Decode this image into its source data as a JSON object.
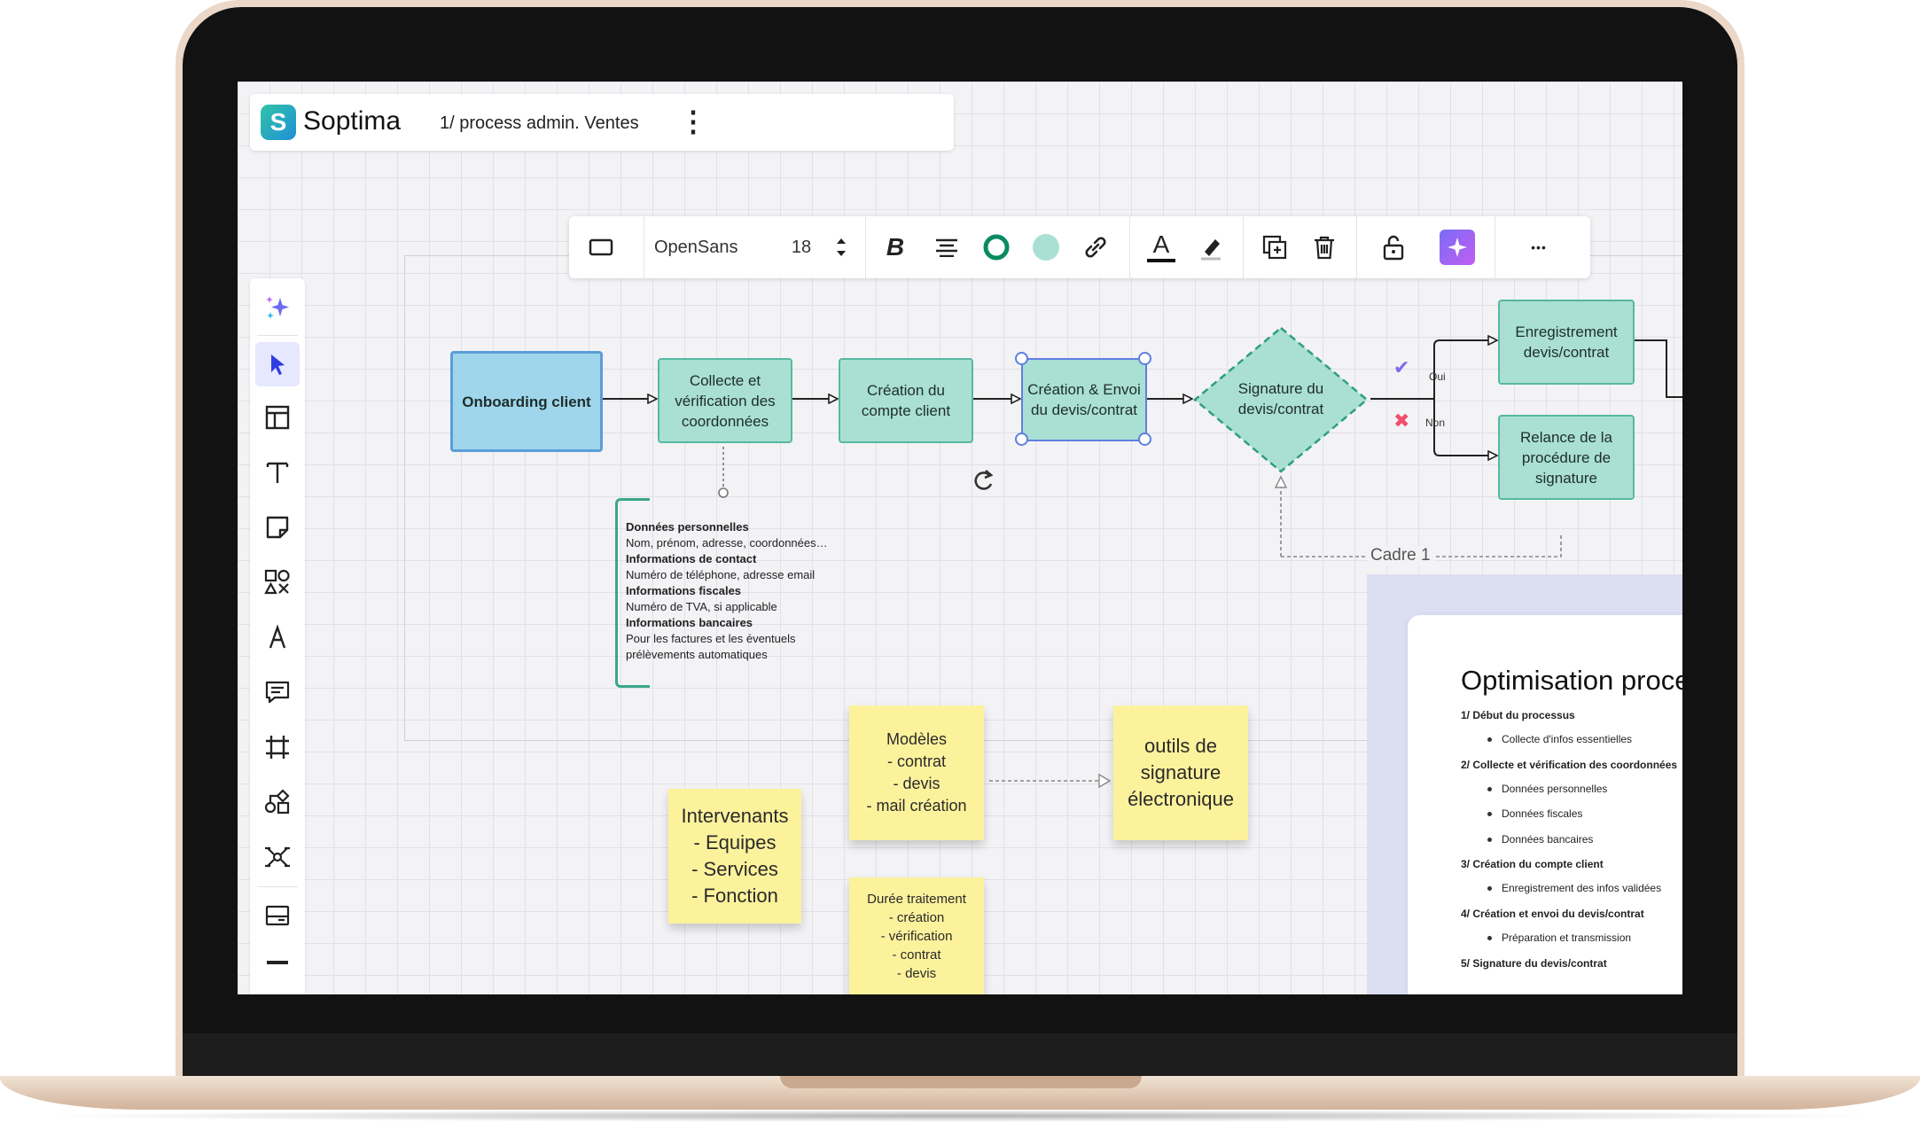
{
  "app": {
    "name": "Soptima",
    "logo_letter": "S",
    "board_title": "1/ process admin. Ventes",
    "menu_glyph": "⋮"
  },
  "toolbar": {
    "font_family": "OpenSans",
    "font_size": "18",
    "bold_glyph": "B",
    "text_color_glyph": "A",
    "more_glyph": "•••"
  },
  "flow": {
    "onboarding": "Onboarding client",
    "collecte": "Collecte et vérification des coordonnées",
    "creation_compte": "Création du compte client",
    "creation_envoi": "Création & Envoi du devis/contrat",
    "signature": "Signature du devis/contrat",
    "enregistrement": "Enregistrement devis/contrat",
    "relance": "Relance de la procédure de signature",
    "oui": "Oui",
    "non": "Non",
    "check_glyph": "✔",
    "cross_glyph": "✖",
    "frame_label": "Cadre 1"
  },
  "notes": [
    {
      "text": "Données personnelles",
      "bold": true
    },
    {
      "text": "Nom, prénom, adresse, coordonnées…",
      "bold": false
    },
    {
      "text": "Informations de contact",
      "bold": true
    },
    {
      "text": "Numéro de téléphone, adresse email",
      "bold": false
    },
    {
      "text": "Informations fiscales",
      "bold": true
    },
    {
      "text": "Numéro de TVA, si applicable",
      "bold": false
    },
    {
      "text": "Informations bancaires",
      "bold": true
    },
    {
      "text": "Pour les factures et les éventuels",
      "bold": false
    },
    {
      "text": "prélèvements automatiques",
      "bold": false
    }
  ],
  "stickies": {
    "intervenants": [
      "Intervenants",
      "- Equipes",
      "- Services",
      "- Fonction"
    ],
    "modeles": [
      "Modèles",
      "- contrat",
      "- devis",
      "- mail création"
    ],
    "outils": [
      "outils de",
      "signature",
      "électronique"
    ],
    "duree": [
      "Durée traitement",
      "- création",
      "- vérification",
      "- contrat",
      "- devis"
    ]
  },
  "document": {
    "title": "Optimisation processus",
    "items": [
      {
        "text": "1/ Début du processus",
        "level": 0
      },
      {
        "text": "Collecte d'infos essentielles",
        "level": 1
      },
      {
        "text": "2/ Collecte et vérification des coordonnées",
        "level": 0
      },
      {
        "text": "Données personnelles",
        "level": 1
      },
      {
        "text": "Données fiscales",
        "level": 1
      },
      {
        "text": "Données bancaires",
        "level": 1
      },
      {
        "text": "3/ Création du compte client",
        "level": 0
      },
      {
        "text": "Enregistrement des infos validées",
        "level": 1
      },
      {
        "text": "4/ Création et envoi du devis/contrat",
        "level": 0
      },
      {
        "text": "Préparation et transmission",
        "level": 1
      },
      {
        "text": "5/ Signature du devis/contrat",
        "level": 0
      }
    ]
  },
  "colors": {
    "accent": "#5e7fe0",
    "node_fill": "#a9e0d3",
    "node_border": "#57b8a0",
    "start_fill": "#9fd6ec",
    "sticky": "#fdf29c",
    "ai_button": "#a070f0"
  },
  "icons": {
    "left_toolbar": [
      "sparkle-icon",
      "pointer-icon",
      "template-icon",
      "text-icon",
      "sticky-note-icon",
      "shapes-icon",
      "pen-icon",
      "comment-icon",
      "frame-icon",
      "diagram-icon",
      "mindmap-icon",
      "card-icon"
    ]
  }
}
